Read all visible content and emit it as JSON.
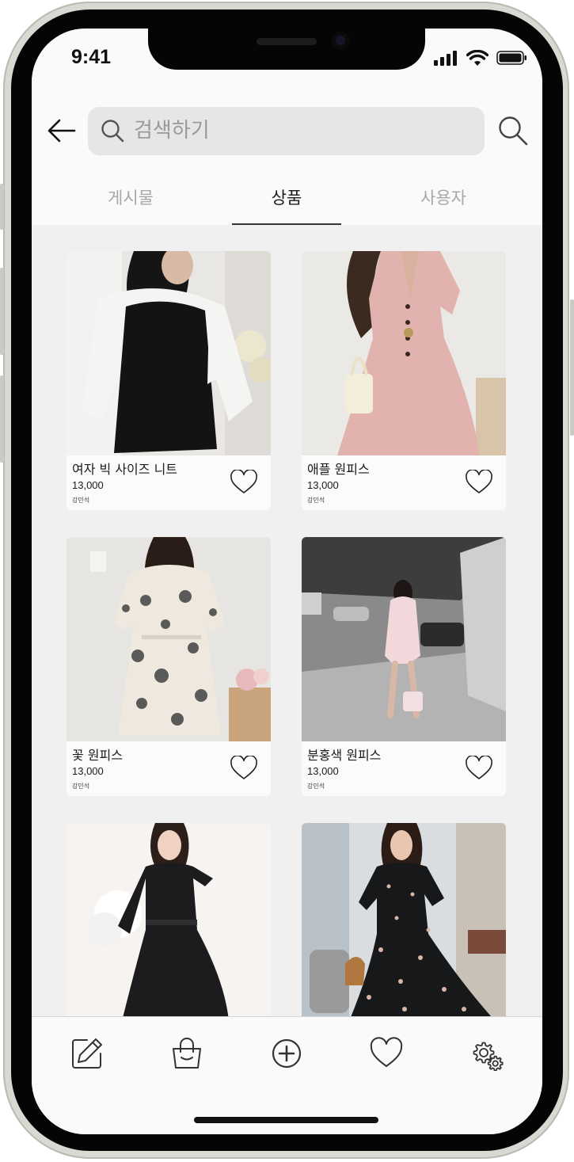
{
  "status_bar": {
    "time": "9:41"
  },
  "search": {
    "placeholder": "검색하기",
    "value": ""
  },
  "tabs": [
    {
      "label": "게시물",
      "active": false
    },
    {
      "label": "상품",
      "active": true
    },
    {
      "label": "사용자",
      "active": false
    }
  ],
  "products": [
    {
      "name": "여자 빅 사이즈 니트",
      "price": "13,000",
      "seller": "강민석",
      "liked": false
    },
    {
      "name": "애플 원피스",
      "price": "13,000",
      "seller": "강민석",
      "liked": false
    },
    {
      "name": "꽃 원피스",
      "price": "13,000",
      "seller": "강민석",
      "liked": false
    },
    {
      "name": "분홍색 원피스",
      "price": "13,000",
      "seller": "강민석",
      "liked": false
    },
    {
      "name": "",
      "price": "",
      "seller": "",
      "liked": false
    },
    {
      "name": "",
      "price": "",
      "seller": "",
      "liked": false
    }
  ],
  "bottom_nav": [
    {
      "icon": "pencil-icon"
    },
    {
      "icon": "shopping-bag-icon"
    },
    {
      "icon": "plus-circle-icon"
    },
    {
      "icon": "heart-icon"
    },
    {
      "icon": "gear-icon"
    }
  ],
  "colors": {
    "background": "#f0f0f0",
    "surface": "#fafafa",
    "search_field": "#e6e6e6",
    "active_tab": "#1a1a1a",
    "inactive_tab": "#a8a8a8"
  }
}
